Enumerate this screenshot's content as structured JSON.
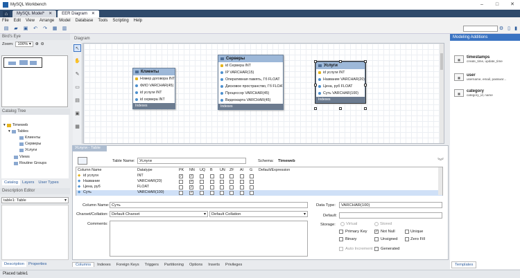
{
  "window": {
    "title": "MySQL Workbench"
  },
  "tabs": [
    {
      "label": "MySQL Model*"
    },
    {
      "label": "EER Diagram"
    }
  ],
  "menu": [
    "File",
    "Edit",
    "View",
    "Arrange",
    "Model",
    "Database",
    "Tools",
    "Scripting",
    "Help"
  ],
  "left": {
    "birds_eye": "Bird's Eye",
    "zoom_label": "Zoom:",
    "zoom_value": "100%",
    "catalog_tree": "Catalog Tree",
    "schema": "Timeweb",
    "tables": "Tables",
    "t1": "Клиенты",
    "t2": "Серверы",
    "t3": "Услуги",
    "views": "Views",
    "routines": "Routine Groups",
    "subtabs": [
      "Catalog",
      "Layers",
      "User Types"
    ],
    "desc_head": "Description Editor",
    "desc_select": "table1: Table",
    "bottom_tabs": [
      "Description",
      "Properties"
    ]
  },
  "diagram": {
    "label": "Diagram",
    "clients": {
      "name": "Клиенты",
      "cols": [
        "Номер договора INT",
        "ФИО VARCHAR(45)",
        "id услуги INT",
        "id сервера INT"
      ],
      "footer": "Indexes"
    },
    "servers": {
      "name": "Серверы",
      "cols": [
        "id Сервера INT",
        "IP VARCHAR(15)",
        "Оперативная память, Гб FLOAT",
        "Дисковое пространство, Гб FLOAT",
        "Процессор VARCHAR(45)",
        "Видеокарта VARCHAR(45)"
      ],
      "footer": "Indexes"
    },
    "services": {
      "name": "Услуги",
      "cols": [
        "id услуги INT",
        "Название VARCHAR(20)",
        "Цена, руб FLOAT",
        "Суть VARCHAR(100)"
      ],
      "footer": "Indexes"
    }
  },
  "editor": {
    "tab": "Услуги - Table",
    "table_name_label": "Table Name:",
    "table_name": "Услуги",
    "schema_label": "Schema:",
    "schema": "Timeweb",
    "headers": [
      "Column Name",
      "Datatype",
      "PK",
      "NN",
      "UQ",
      "B",
      "UN",
      "ZF",
      "AI",
      "G",
      "Default/Expression"
    ],
    "rows": [
      {
        "name": "id услуги",
        "type": "INT"
      },
      {
        "name": "Название",
        "type": "VARCHAR(20)"
      },
      {
        "name": "Цена, руб",
        "type": "FLOAT"
      },
      {
        "name": "Суть",
        "type": "VARCHAR(100)"
      }
    ],
    "column_name_label": "Column Name:",
    "column_name": "Суть",
    "charset_label": "Charset/Collation:",
    "charset": "Default Charset",
    "collation": "Default Collation",
    "comments_label": "Comments:",
    "datatype_label": "Data Type:",
    "datatype": "VARCHAR(100)",
    "default_label": "Default:",
    "storage_label": "Storage:",
    "storage": {
      "virtual": "Virtual",
      "stored": "Stored",
      "pk": "Primary Key",
      "nn": "Not Null",
      "unique": "Unique",
      "binary": "Binary",
      "unsigned": "Unsigned",
      "zero": "Zero Fill",
      "ai": "Auto Increment",
      "gen": "Generated"
    },
    "bottom_tabs": [
      "Columns",
      "Indexes",
      "Foreign Keys",
      "Triggers",
      "Partitioning",
      "Options",
      "Inserts",
      "Privileges"
    ]
  },
  "right": {
    "header": "Modeling Additions",
    "snippets": [
      {
        "title": "timestamps",
        "desc": "create_time, update_time"
      },
      {
        "title": "user",
        "desc": "username, email, passwor..."
      },
      {
        "title": "category",
        "desc": "category_id, name"
      }
    ],
    "bottom_tab": "Templates"
  },
  "status": "Placed table1"
}
